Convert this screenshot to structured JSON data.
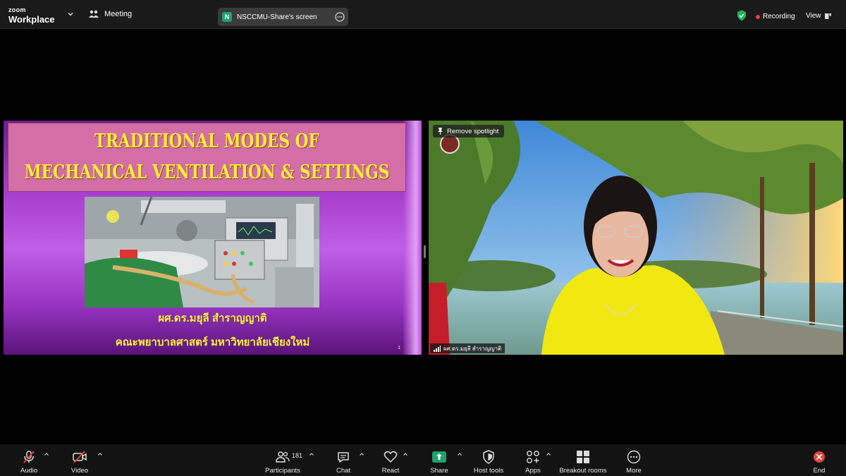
{
  "app": {
    "brand_small": "zoom",
    "brand_name": "Workplace"
  },
  "header": {
    "meeting_label": "Meeting",
    "share_badge": "N",
    "share_title": "NSCCMU-Share's screen",
    "recording_label": "Recording",
    "view_label": "View"
  },
  "slide": {
    "title_line1": "TRADITIONAL MODES OF",
    "title_line2": "MECHANICAL VENTILATION & SETTINGS",
    "author": "ผศ.ดร.มยุลี สำราญญาติ",
    "faculty": "คณะพยาบาลศาสตร์ มหาวิทยาลัยเชียงใหม่",
    "page_number": "1"
  },
  "video": {
    "remove_spotlight": "Remove spotlight",
    "participant_name": "ผศ.ดร.มยุลี สำราญญาติ"
  },
  "toolbar": {
    "audio": "Audio",
    "video": "Video",
    "participants": "Participants",
    "participants_count": "181",
    "chat": "Chat",
    "react": "React",
    "share": "Share",
    "host_tools": "Host tools",
    "apps": "Apps",
    "breakout": "Breakout rooms",
    "more": "More",
    "end": "End"
  },
  "colors": {
    "share_green": "#1fa36a",
    "recording_red": "#e0443e",
    "end_red": "#e0443e",
    "slide_title": "#ffee3a",
    "slide_title_box": "#d46ea6"
  }
}
